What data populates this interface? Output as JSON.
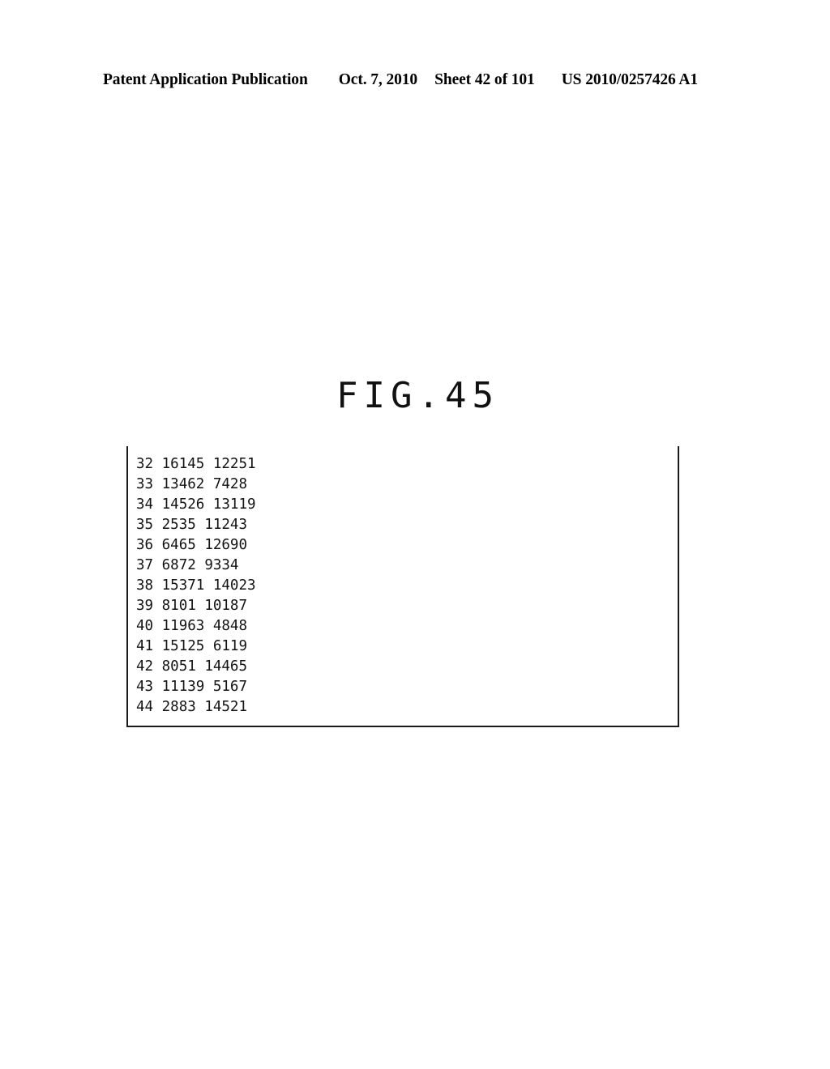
{
  "page": {
    "background_color": "#ffffff",
    "ink_color": "#131313"
  },
  "header": {
    "publication_label": "Patent Application Publication",
    "date": "Oct. 7, 2010",
    "sheet": "Sheet 42 of 101",
    "document_number": "US 2010/0257426 A1"
  },
  "figure": {
    "label": "FIG.45",
    "frame": {
      "has_top_border": false,
      "has_left_border": true,
      "has_right_border": true,
      "has_bottom_border": true,
      "border_color": "#1a1a1a"
    }
  },
  "listing": {
    "columns": [
      "index",
      "value_a",
      "value_b"
    ],
    "rows": [
      {
        "index": "32",
        "value_a": "16145",
        "value_b": "12251"
      },
      {
        "index": "33",
        "value_a": "13462",
        "value_b": "7428"
      },
      {
        "index": "34",
        "value_a": "14526",
        "value_b": "13119"
      },
      {
        "index": "35",
        "value_a": "2535",
        "value_b": "11243"
      },
      {
        "index": "36",
        "value_a": "6465",
        "value_b": "12690"
      },
      {
        "index": "37",
        "value_a": "6872",
        "value_b": "9334"
      },
      {
        "index": "38",
        "value_a": "15371",
        "value_b": "14023"
      },
      {
        "index": "39",
        "value_a": "8101",
        "value_b": "10187"
      },
      {
        "index": "40",
        "value_a": "11963",
        "value_b": "4848"
      },
      {
        "index": "41",
        "value_a": "15125",
        "value_b": "6119"
      },
      {
        "index": "42",
        "value_a": "8051",
        "value_b": "14465"
      },
      {
        "index": "43",
        "value_a": "11139",
        "value_b": "5167"
      },
      {
        "index": "44",
        "value_a": "2883",
        "value_b": "14521"
      }
    ]
  }
}
